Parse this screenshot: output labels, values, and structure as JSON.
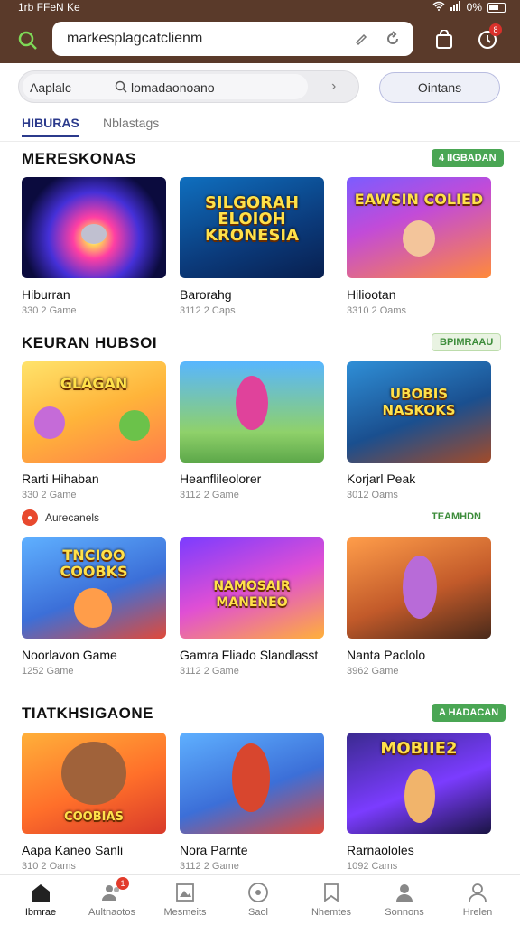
{
  "status_bar": {
    "time": "1rb FFeN Ke",
    "battery": "0%"
  },
  "app_bar": {
    "url": "markesplagcatclienm",
    "badge": "8"
  },
  "filter": {
    "label": "Aaplalc",
    "query": "lomadaonoano",
    "options_label": "Ointans"
  },
  "tabs": [
    {
      "label": "HIBURAS"
    },
    {
      "label": "Nblastags"
    }
  ],
  "sections": [
    {
      "title": "MERESKONAS",
      "pill": "4 IIGBADAN",
      "cards": [
        {
          "title": "Hiburran",
          "sub": "330 2 Game",
          "caption": ""
        },
        {
          "title": "Barorahg",
          "sub": "3112 2 Caps",
          "caption": "SILGORAH ELOIOH KRONESIA"
        },
        {
          "title": "Hiliootan",
          "sub": "3310 2 Oams",
          "caption": "EAWSIN COLIED"
        }
      ]
    },
    {
      "title": "KEURAN HUBSOI",
      "pill": "BPIMRAAU",
      "cards": [
        {
          "title": "Rarti Hihaban",
          "sub": "330 2 Game",
          "caption": "GLAGAN"
        },
        {
          "title": "Heanflileolorer",
          "sub": "3112 2 Game",
          "caption": ""
        },
        {
          "title": "Korjarl Peak",
          "sub": "3012 Oams",
          "caption": "UBOBIS NASKOKS"
        }
      ]
    },
    {
      "title": "Aurecanels",
      "pill": "TEAMHDN",
      "cards": [
        {
          "title": "Noorlavon Game",
          "sub": "1252 Game",
          "caption": "TNCIOO COOBKS"
        },
        {
          "title": "Gamra Fliado Slandlasst",
          "sub": "3112 2 Game",
          "caption": "NAMOSAIR MANENEO"
        },
        {
          "title": "Nanta Paclolo",
          "sub": "3962 Game",
          "caption": ""
        }
      ]
    },
    {
      "title": "TIATKHSIGAONE",
      "pill": "A HADACAN",
      "cards": [
        {
          "title": "Aapa Kaneo Sanli",
          "sub": "310 2 Oams",
          "caption": "COOBIAS"
        },
        {
          "title": "Nora Parnte",
          "sub": "3112 2 Game",
          "caption": ""
        },
        {
          "title": "Rarnaololes",
          "sub": "1092 Cams",
          "caption": "MOBIIE2"
        }
      ]
    }
  ],
  "bottom_nav": [
    {
      "label": "Ibmrae",
      "icon": "home-icon"
    },
    {
      "label": "Aultnaotos",
      "icon": "community-icon",
      "badge": "1"
    },
    {
      "label": "Mesmeits",
      "icon": "gallery-icon"
    },
    {
      "label": "Saol",
      "icon": "disc-icon"
    },
    {
      "label": "Nhemtes",
      "icon": "bookmark-icon"
    },
    {
      "label": "Sonnons",
      "icon": "profile-icon"
    },
    {
      "label": "Hrelen",
      "icon": "user-icon"
    }
  ]
}
